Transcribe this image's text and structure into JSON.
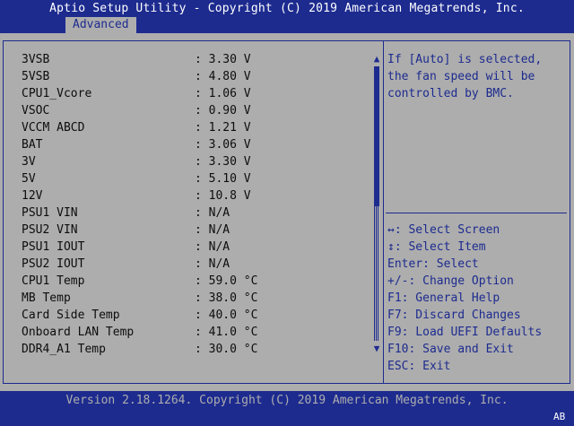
{
  "header": {
    "title": "Aptio Setup Utility - Copyright (C) 2019 American Megatrends, Inc.",
    "active_tab": "Advanced"
  },
  "readings": [
    {
      "label": "3VSB",
      "value": ": 3.30 V"
    },
    {
      "label": "5VSB",
      "value": ": 4.80 V"
    },
    {
      "label": "CPU1_Vcore",
      "value": ": 1.06 V"
    },
    {
      "label": "VSOC",
      "value": ": 0.90 V"
    },
    {
      "label": "VCCM ABCD",
      "value": ": 1.21 V"
    },
    {
      "label": "BAT",
      "value": ": 3.06 V"
    },
    {
      "label": "3V",
      "value": ": 3.30 V"
    },
    {
      "label": "5V",
      "value": ": 5.10 V"
    },
    {
      "label": "12V",
      "value": ": 10.8 V"
    },
    {
      "label": "PSU1 VIN",
      "value": ": N/A"
    },
    {
      "label": "PSU2 VIN",
      "value": ": N/A"
    },
    {
      "label": "PSU1 IOUT",
      "value": ": N/A"
    },
    {
      "label": "PSU2 IOUT",
      "value": ": N/A"
    },
    {
      "label": "CPU1 Temp",
      "value": ": 59.0 °C"
    },
    {
      "label": "MB Temp",
      "value": ": 38.0 °C"
    },
    {
      "label": "Card Side Temp",
      "value": ": 40.0 °C"
    },
    {
      "label": "Onboard LAN Temp",
      "value": ": 41.0 °C"
    },
    {
      "label": "DDR4_A1 Temp",
      "value": ": 30.0 °C"
    }
  ],
  "scrollbar": {
    "up_arrow": "▲",
    "down_arrow": "▼"
  },
  "help_text": "If [Auto] is selected, the fan speed will be controlled by BMC.",
  "key_help": [
    "↔: Select Screen",
    "↕: Select Item",
    "Enter: Select",
    "+/-: Change Option",
    "F1: General Help",
    "F7: Discard Changes",
    "F9: Load UEFI Defaults",
    "F10: Save and Exit",
    "ESC: Exit"
  ],
  "footer": {
    "version": "Version 2.18.1264. Copyright (C) 2019 American Megatrends, Inc.",
    "badge": "AB"
  },
  "colors": {
    "primary_blue": "#1d2b8f",
    "background_gray": "#adadad",
    "text_dark": "#0d0d0d",
    "white": "#ffffff"
  }
}
